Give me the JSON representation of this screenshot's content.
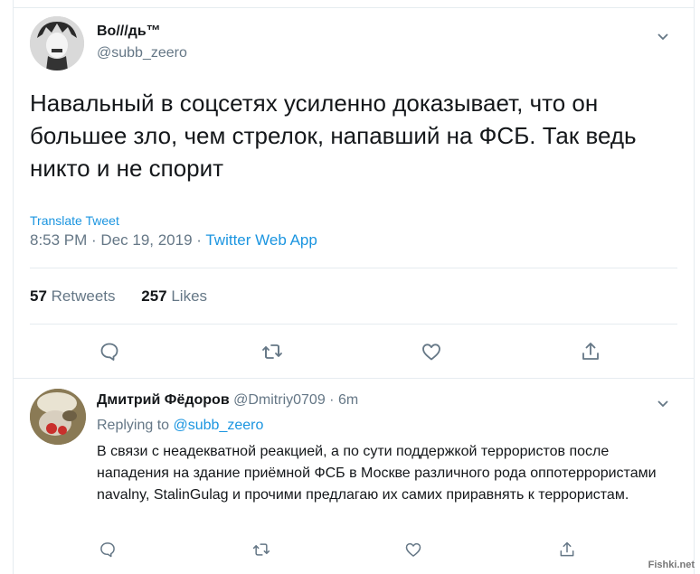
{
  "tweet": {
    "author_name": "Во///дь™",
    "author_handle": "@subb_zeero",
    "text": "Навальный в соцсетях усиленно доказывает, что он большее зло, чем стрелок, напавший на ФСБ. Так ведь никто и не спорит",
    "translate_label": "Translate Tweet",
    "timestamp": "8:53 PM · Dec 19, 2019 · ",
    "source_app": "Twitter Web App",
    "retweets_count": "57",
    "retweets_label": " Retweets",
    "likes_count": "257",
    "likes_label": " Likes"
  },
  "reply": {
    "author_name": "Дмитрий Фёдоров",
    "author_handle": " @Dmitriy0709 · 6m",
    "replying_prefix": "Replying to ",
    "replying_to": "@subb_zeero",
    "text": "В связи с неадекватной реакцией, а по сути поддержкой террористов после нападения на здание приёмной ФСБ в Москве различного рода оппотеррористами navalny, StalinGulag и прочими предлагаю их самих приравнять к террористам."
  },
  "icons": {
    "menu": "chevron-down-icon",
    "reply": "comment-icon",
    "retweet": "retweet-icon",
    "like": "heart-icon",
    "share": "share-icon"
  },
  "colors": {
    "accent": "#1b95e0",
    "muted": "#657786",
    "text": "#14171a",
    "divider": "#e6ecf0"
  },
  "watermark": "Fishki.net"
}
